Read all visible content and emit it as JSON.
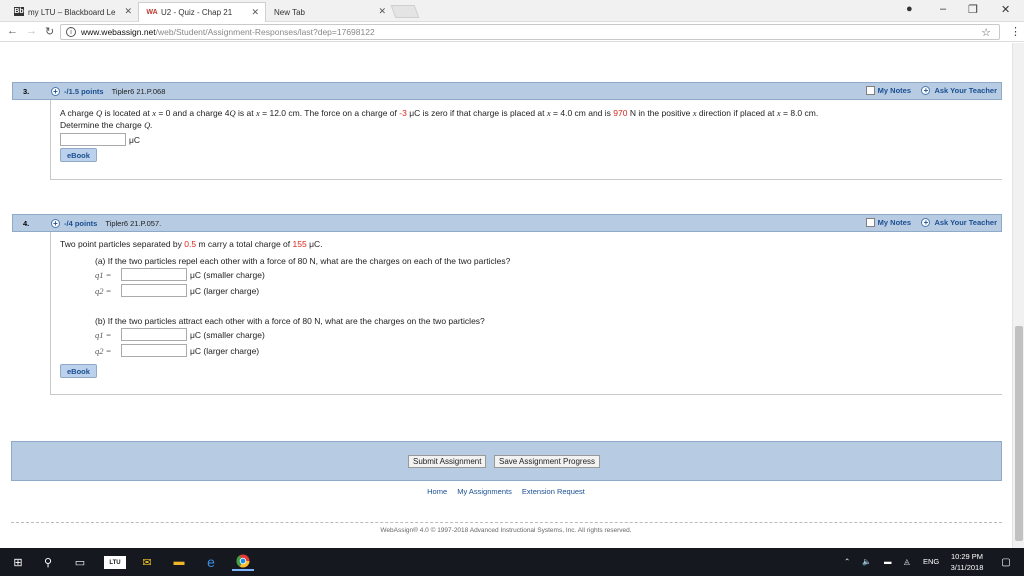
{
  "browser": {
    "tabs": [
      {
        "label": "my LTU – Blackboard Le",
        "icon": "blackboard-icon",
        "active": false
      },
      {
        "label": "U2 - Quiz - Chap 21",
        "icon": "webassign-icon",
        "active": true
      },
      {
        "label": "New Tab",
        "icon": "",
        "active": false
      }
    ],
    "tab_favicon_bb": "Bb",
    "tab_favicon_wa": "WA",
    "url_host": "www.webassign.net",
    "url_path": "/web/Student/Assignment-Responses/last?dep=17698122"
  },
  "questions": [
    {
      "number": "3.",
      "points": "-/1.5 points",
      "source": "Tipler6 21.P.068",
      "my_notes": "My Notes",
      "ask_teacher": "Ask Your Teacher",
      "text_1": "A charge",
      "var_Q": "Q",
      "text_2": "is located at",
      "var_x": "x",
      "text_3": "= 0 and a charge 4",
      "text_4": "is at",
      "text_5": "= 12.0 cm. The force on a charge of",
      "charge_value": "-3",
      "text_6": "μC is zero if that charge is placed at",
      "text_7": "= 4.0 cm and is",
      "force_value": "970",
      "text_8": "N in the positive",
      "text_9": "direction if placed at",
      "text_10": "= 8.0 cm.",
      "line2": "Determine the charge",
      "line2_var": "Q.",
      "unit": "μC",
      "ebook": "eBook"
    },
    {
      "number": "4.",
      "points": "-/4 points",
      "source": "Tipler6 21.P.057.",
      "my_notes": "My Notes",
      "ask_teacher": "Ask Your Teacher",
      "intro_1": "Two point particles separated by",
      "distance": "0.5",
      "intro_2": "m carry a total charge of",
      "total_charge": "155",
      "intro_3": "μC.",
      "part_a": "(a) If the two particles repel each other with a force of 80 N, what are the charges on each of the two particles?",
      "part_b": "(b) If the two particles attract each other with a force of 80 N, what are the charges on the two particles?",
      "q1_label": "q1 =",
      "q2_label": "q2 =",
      "smaller": "μC (smaller charge)",
      "larger": "μC (larger charge)",
      "ebook": "eBook"
    }
  ],
  "footer": {
    "submit_label": "Submit Assignment",
    "save_label": "Save Assignment Progress",
    "links": [
      "Home",
      "My Assignments",
      "Extension Request"
    ],
    "copyright": "WebAssign® 4.0 © 1997-2018 Advanced Instructional Systems, Inc. All rights reserved."
  },
  "taskbar": {
    "lang": "ENG",
    "time": "10:29 PM",
    "date": "3/11/2018",
    "pinned_bb": "LTU"
  }
}
